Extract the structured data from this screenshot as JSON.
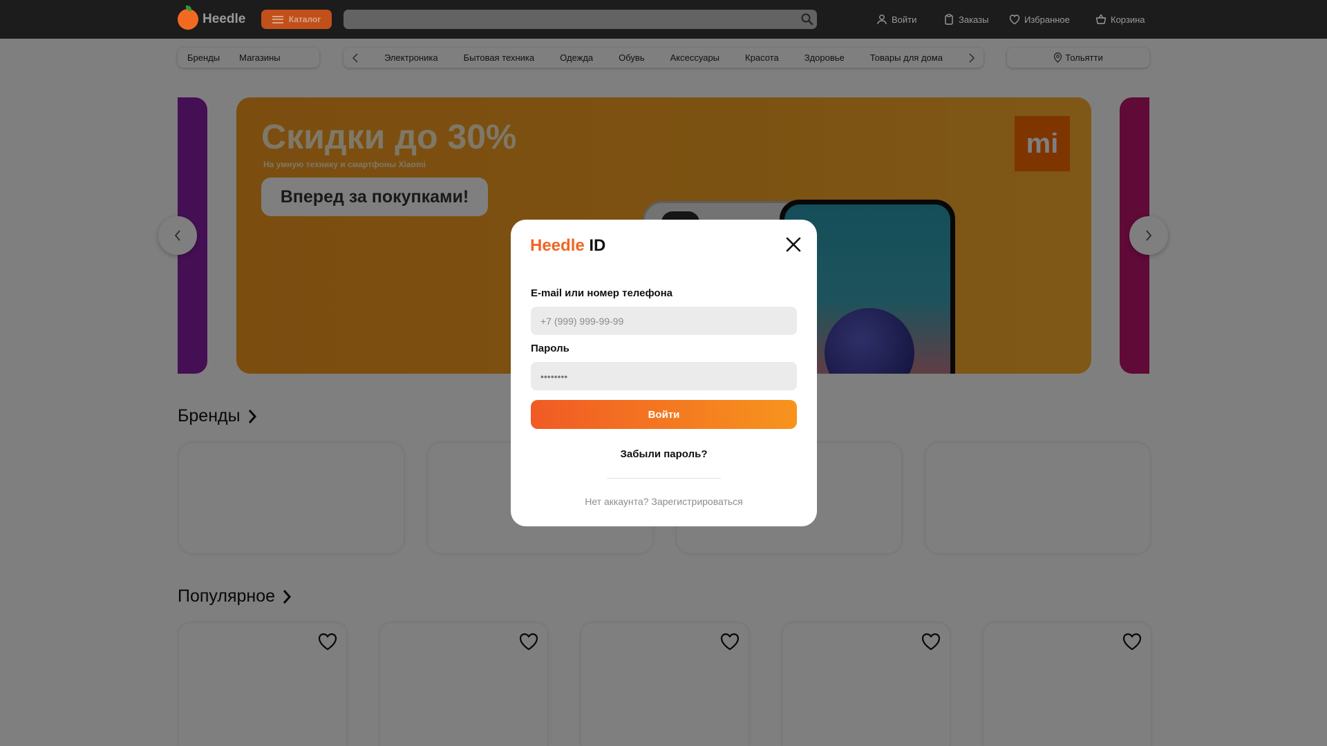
{
  "header": {
    "logo_text": "Heedle",
    "catalog_label": "Каталог",
    "search_placeholder": "",
    "nav": {
      "login": "Войти",
      "orders": "Заказы",
      "favorites": "Избранное",
      "cart": "Корзина"
    }
  },
  "subnav": {
    "left_links": [
      "Бренды",
      "Магазины"
    ],
    "categories": [
      "Электроника",
      "Бытовая техника",
      "Одежда",
      "Обувь",
      "Аксессуары",
      "Красота",
      "Здоровье",
      "Товары для дома"
    ],
    "city": "Тольятти"
  },
  "banner": {
    "title": "Скидки до 30%",
    "subtitle": "На умную технику и смартфоны Xiaomi",
    "cta": "Вперед за покупками!",
    "logo": "mi",
    "colors": {
      "main": "#f9a524",
      "left_peek": "#8b1fa9",
      "right_peek": "#c0146e"
    }
  },
  "sections": {
    "brands": "Бренды",
    "popular": "Популярное"
  },
  "modal": {
    "title_brand": "Heedle",
    "title_id": "ID",
    "email_label": "E-mail или номер телефона",
    "email_placeholder": "+7 (999) 999-99-99",
    "password_label": "Пароль",
    "password_value": "••••••••",
    "submit": "Войти",
    "forgot": "Забыли пароль?",
    "register": "Нет аккаунта? Зарегистрироваться",
    "accent_color": "#f26522"
  }
}
